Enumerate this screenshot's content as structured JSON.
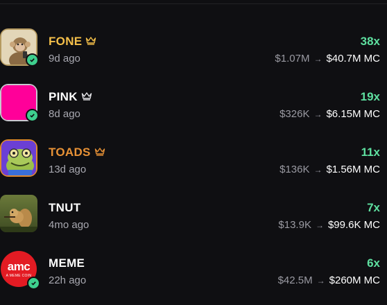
{
  "tokens": [
    {
      "name": "FONE",
      "name_color": "#f5c04a",
      "crown": true,
      "age": "9d ago",
      "multiplier": "38x",
      "from_mc": "$1.07M",
      "to_mc": "$40.7M MC"
    },
    {
      "name": "PINK",
      "name_color": "#ffffff",
      "crown": true,
      "age": "8d ago",
      "multiplier": "19x",
      "from_mc": "$326K",
      "to_mc": "$6.15M MC"
    },
    {
      "name": "TOADS",
      "name_color": "#e89236",
      "crown": true,
      "age": "13d ago",
      "multiplier": "11x",
      "from_mc": "$136K",
      "to_mc": "$1.56M MC"
    },
    {
      "name": "TNUT",
      "name_color": "#ffffff",
      "crown": false,
      "age": "4mo ago",
      "multiplier": "7x",
      "from_mc": "$13.9K",
      "to_mc": "$99.6K MC"
    },
    {
      "name": "MEME",
      "name_color": "#ffffff",
      "crown": false,
      "age": "22h ago",
      "multiplier": "6x",
      "from_mc": "$42.5M",
      "to_mc": "$260M MC"
    }
  ],
  "meme_logo": {
    "brand": "amc",
    "caption": "A MEME COIN"
  },
  "colors": {
    "accent_green": "#5ee0a0",
    "verified": "#3ecf8e",
    "background": "#0f0f12"
  }
}
